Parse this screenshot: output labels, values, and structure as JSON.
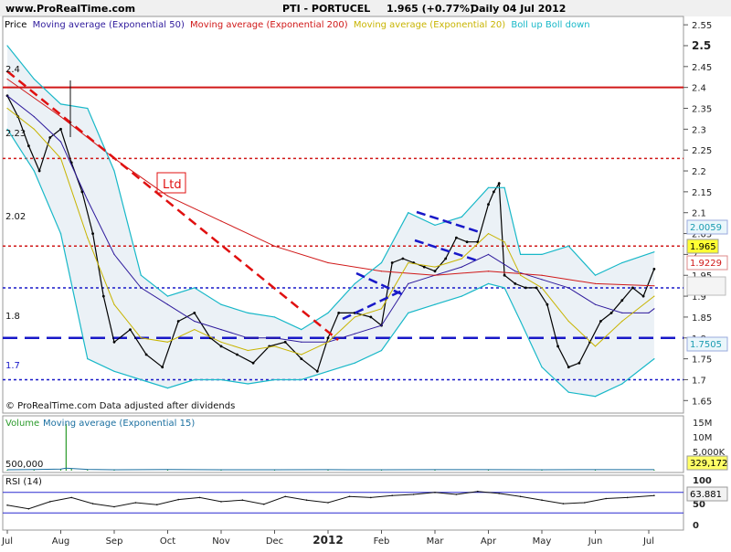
{
  "header": {
    "site": "www.ProRealTime.com",
    "symbol": "PTI - PORTUCEL",
    "price_change": "1.965 (+0.77%)",
    "period": "Daily  04 Jul 2012"
  },
  "price_panel": {
    "legend": [
      {
        "text": "Price",
        "color": "#000000"
      },
      {
        "text": "Moving average (Exponential 50)",
        "color": "#2e1a9c"
      },
      {
        "text": "Moving average (Exponential 200)",
        "color": "#d01818"
      },
      {
        "text": "Moving average (Exponential 20)",
        "color": "#c8b400"
      },
      {
        "text": "Boll up Boll down",
        "color": "#18b8c8"
      }
    ],
    "footer": "© ProRealTime.com  Data adjusted after dividends",
    "annotation": "Ltd",
    "level_labels": [
      "2.4",
      "2.23",
      "2.02",
      "1.8",
      "1.7"
    ],
    "badges": [
      {
        "value": "2.0059",
        "bg": "#eaf6fb",
        "color": "#1a9cb0"
      },
      {
        "value": "1.965",
        "bg": "#ffff33",
        "color": "#000000"
      },
      {
        "value": "1.9229",
        "bg": "#ffffff",
        "color": "#d01818"
      },
      {
        "value": "1.7505",
        "bg": "#eaf6fb",
        "color": "#1a9cb0"
      }
    ]
  },
  "volume_panel": {
    "label_volume": "Volume",
    "label_ma": "Moving average (Exponential 15)",
    "left_value": "500,000",
    "badge": "329,172",
    "axis": [
      "15M",
      "10M",
      "5,000K"
    ]
  },
  "rsi_panel": {
    "label": "RSI (14)",
    "badge": "63.881",
    "axis": [
      "100",
      "50",
      "0"
    ]
  },
  "chart_data": {
    "type": "line",
    "title": "PTI - PORTUCEL",
    "subtitle": "Daily  04 Jul 2012",
    "ylim": [
      1.62,
      2.57
    ],
    "y_ticks": [
      "2.55",
      "2.5",
      "2.45",
      "2.4",
      "2.35",
      "2.3",
      "2.25",
      "2.2",
      "2.15",
      "2.1",
      "2.05",
      "2",
      "1.95",
      "1.9",
      "1.85",
      "1.8",
      "1.75",
      "1.7",
      "1.65"
    ],
    "y_tick_values": [
      2.55,
      2.5,
      2.45,
      2.4,
      2.35,
      2.3,
      2.25,
      2.2,
      2.15,
      2.1,
      2.05,
      2.0,
      1.95,
      1.9,
      1.85,
      1.8,
      1.75,
      1.7,
      1.65
    ],
    "x_labels": [
      "Jul",
      "Aug",
      "Sep",
      "Oct",
      "Nov",
      "Dec",
      "2012",
      "Feb",
      "Mar",
      "Apr",
      "May",
      "Jun",
      "Jul"
    ],
    "x_months": [
      0,
      1,
      2,
      3,
      4,
      5,
      6,
      7,
      8,
      9,
      10,
      11,
      12
    ],
    "grid": false,
    "legend_position": "top-left",
    "series": [
      {
        "name": "Price",
        "color": "#000000",
        "x": [
          0,
          0.2,
          0.4,
          0.6,
          0.8,
          1.0,
          1.2,
          1.4,
          1.6,
          1.8,
          2.0,
          2.3,
          2.6,
          2.9,
          3.2,
          3.5,
          3.8,
          4.0,
          4.3,
          4.6,
          4.9,
          5.2,
          5.5,
          5.8,
          6.0,
          6.2,
          6.5,
          6.8,
          7.0,
          7.2,
          7.4,
          7.6,
          7.8,
          8.0,
          8.2,
          8.4,
          8.6,
          8.8,
          9.0,
          9.1,
          9.2,
          9.3,
          9.5,
          9.7,
          9.9,
          10.1,
          10.3,
          10.5,
          10.7,
          10.9,
          11.1,
          11.3,
          11.5,
          11.7,
          11.9,
          12.1
        ],
        "y": [
          2.38,
          2.33,
          2.26,
          2.2,
          2.28,
          2.3,
          2.22,
          2.15,
          2.05,
          1.9,
          1.79,
          1.82,
          1.76,
          1.73,
          1.84,
          1.86,
          1.8,
          1.78,
          1.76,
          1.74,
          1.78,
          1.79,
          1.75,
          1.72,
          1.8,
          1.86,
          1.86,
          1.85,
          1.83,
          1.98,
          1.99,
          1.98,
          1.97,
          1.96,
          1.99,
          2.04,
          2.03,
          2.03,
          2.12,
          2.15,
          2.17,
          1.95,
          1.93,
          1.92,
          1.92,
          1.88,
          1.78,
          1.73,
          1.74,
          1.79,
          1.84,
          1.86,
          1.89,
          1.92,
          1.9,
          1.965
        ]
      },
      {
        "name": "Moving average (Exponential 50)",
        "color": "#2e1a9c",
        "x": [
          0,
          0.5,
          1.0,
          1.5,
          2.0,
          2.5,
          3.0,
          3.5,
          4.0,
          4.5,
          5.0,
          5.5,
          6.0,
          6.5,
          7.0,
          7.5,
          8.0,
          8.5,
          9.0,
          9.5,
          10.0,
          10.5,
          11.0,
          11.5,
          12.0,
          12.1
        ],
        "y": [
          2.38,
          2.33,
          2.27,
          2.13,
          2.0,
          1.92,
          1.88,
          1.84,
          1.82,
          1.8,
          1.8,
          1.79,
          1.79,
          1.81,
          1.83,
          1.93,
          1.95,
          1.97,
          2.0,
          1.96,
          1.94,
          1.92,
          1.88,
          1.86,
          1.86,
          1.87
        ]
      },
      {
        "name": "Moving average (Exponential 200)",
        "color": "#d01818",
        "x": [
          0,
          1.0,
          2.0,
          3.0,
          4.0,
          5.0,
          6.0,
          7.0,
          8.0,
          9.0,
          10.0,
          11.0,
          12.1
        ],
        "y": [
          2.42,
          2.33,
          2.23,
          2.14,
          2.08,
          2.02,
          1.98,
          1.96,
          1.95,
          1.96,
          1.95,
          1.93,
          1.925
        ]
      },
      {
        "name": "Moving average (Exponential 20)",
        "color": "#c8b400",
        "x": [
          0,
          0.5,
          1.0,
          1.5,
          2.0,
          2.5,
          3.0,
          3.5,
          4.0,
          4.5,
          5.0,
          5.5,
          6.0,
          6.5,
          7.0,
          7.5,
          8.0,
          8.5,
          9.0,
          9.3,
          9.6,
          10.0,
          10.5,
          11.0,
          11.5,
          12.1
        ],
        "y": [
          2.35,
          2.3,
          2.23,
          2.04,
          1.88,
          1.8,
          1.79,
          1.82,
          1.79,
          1.77,
          1.78,
          1.76,
          1.79,
          1.85,
          1.87,
          1.98,
          1.97,
          1.99,
          2.05,
          2.03,
          1.95,
          1.92,
          1.84,
          1.78,
          1.84,
          1.9
        ]
      },
      {
        "name": "Boll up",
        "color": "#18b8c8",
        "x": [
          0,
          0.5,
          1.0,
          1.5,
          2.0,
          2.5,
          3.0,
          3.5,
          4.0,
          4.5,
          5.0,
          5.5,
          6.0,
          6.5,
          7.0,
          7.5,
          8.0,
          8.5,
          9.0,
          9.3,
          9.6,
          10.0,
          10.5,
          11.0,
          11.5,
          12.1
        ],
        "y": [
          2.5,
          2.42,
          2.36,
          2.35,
          2.2,
          1.95,
          1.9,
          1.92,
          1.88,
          1.86,
          1.85,
          1.82,
          1.86,
          1.93,
          1.98,
          2.1,
          2.07,
          2.09,
          2.16,
          2.16,
          2.0,
          2.0,
          2.02,
          1.95,
          1.98,
          2.006
        ]
      },
      {
        "name": "Boll down",
        "color": "#18b8c8",
        "x": [
          0,
          0.5,
          1.0,
          1.5,
          2.0,
          2.5,
          3.0,
          3.5,
          4.0,
          4.5,
          5.0,
          5.5,
          6.0,
          6.5,
          7.0,
          7.5,
          8.0,
          8.5,
          9.0,
          9.3,
          9.6,
          10.0,
          10.5,
          11.0,
          11.5,
          12.1
        ],
        "y": [
          2.3,
          2.2,
          2.05,
          1.75,
          1.72,
          1.7,
          1.68,
          1.7,
          1.7,
          1.69,
          1.7,
          1.7,
          1.72,
          1.74,
          1.77,
          1.86,
          1.88,
          1.9,
          1.93,
          1.92,
          1.84,
          1.73,
          1.67,
          1.66,
          1.69,
          1.75
        ]
      }
    ],
    "horizontal_levels": [
      {
        "value": 2.4,
        "color": "#d01818",
        "style": "solid"
      },
      {
        "value": 2.23,
        "color": "#d01818",
        "style": "dotted"
      },
      {
        "value": 2.02,
        "color": "#d01818",
        "style": "dotted"
      },
      {
        "value": 1.92,
        "color": "#1818c8",
        "style": "dotted"
      },
      {
        "value": 1.8,
        "color": "#1818c8",
        "style": "dashed"
      },
      {
        "value": 1.7,
        "color": "#1818c8",
        "style": "dotted"
      }
    ],
    "volume": {
      "x": [
        0,
        0.5,
        1.0,
        1.1,
        1.2,
        1.5,
        2.0,
        3.0,
        4.0,
        5.0,
        6.0,
        7.0,
        8.0,
        9.0,
        10.0,
        11.0,
        12.1
      ],
      "y": [
        300000,
        350000,
        500000,
        15000000,
        700000,
        400000,
        300000,
        350000,
        300000,
        280000,
        320000,
        300000,
        330000,
        310000,
        300000,
        320000,
        329172
      ],
      "ylim": [
        0,
        17000000
      ]
    },
    "rsi": {
      "x": [
        0,
        0.4,
        0.8,
        1.2,
        1.6,
        2.0,
        2.4,
        2.8,
        3.2,
        3.6,
        4.0,
        4.4,
        4.8,
        5.2,
        5.6,
        6.0,
        6.4,
        6.8,
        7.2,
        7.6,
        8.0,
        8.4,
        8.8,
        9.2,
        9.6,
        10.0,
        10.4,
        10.8,
        11.2,
        11.6,
        12.1
      ],
      "y": [
        45,
        38,
        52,
        60,
        48,
        42,
        50,
        46,
        56,
        60,
        52,
        55,
        47,
        62,
        55,
        50,
        62,
        60,
        64,
        66,
        70,
        66,
        72,
        68,
        62,
        55,
        48,
        50,
        58,
        60,
        63.881
      ],
      "ylim": [
        0,
        100
      ],
      "levels": [
        70,
        30
      ]
    }
  }
}
